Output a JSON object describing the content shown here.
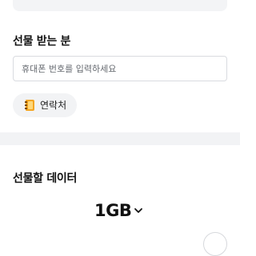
{
  "recipient": {
    "title": "선물 받는 분",
    "phone_input": {
      "value": "",
      "placeholder": "휴대폰 번호를 입력하세요"
    },
    "contacts_button": {
      "icon": "address-book-icon",
      "label": "연락처"
    }
  },
  "gift_data": {
    "title": "선물할 데이터",
    "selected_amount": "1GB",
    "dropdown_icon": "chevron-down-icon"
  },
  "colors": {
    "divider": "#f2f3f5",
    "chip_background": "#f2f3f5",
    "contact_icon": "#f4a623",
    "input_border": "#d9dbe0"
  }
}
